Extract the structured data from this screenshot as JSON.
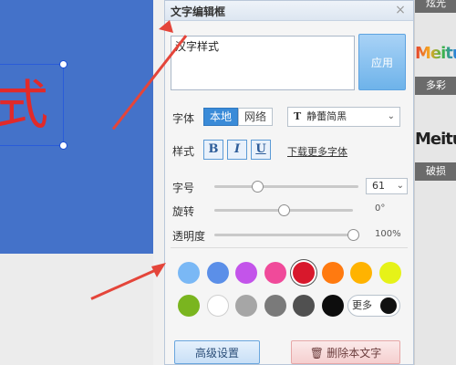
{
  "canvas": {
    "preview_text": "式",
    "preview_color": "#e12a2a",
    "background": "#4472c9"
  },
  "right_strip": [
    {
      "label": "炫光",
      "sample": ""
    },
    {
      "label": "多彩",
      "sample": "Meitu"
    },
    {
      "label": "破损",
      "sample": "Meitu"
    }
  ],
  "dialog": {
    "title": "文字编辑框",
    "close_icon": "×",
    "text_value": "汉字样式",
    "apply_label": "应用",
    "font_label": "字体",
    "font_source": {
      "local": "本地",
      "network": "网络",
      "selected": "local"
    },
    "font_select": {
      "icon": "T",
      "value": "静蕾简黑"
    },
    "style_label": "样式",
    "style_buttons": {
      "bold": "B",
      "italic": "I",
      "underline": "U"
    },
    "more_fonts_link": "下载更多字体",
    "size_label": "字号",
    "size_value": "61",
    "size_position": 0.3,
    "rotate_label": "旋转",
    "rotate_value": "0°",
    "rotate_position": 0.5,
    "opacity_label": "透明度",
    "opacity_value": "100%",
    "opacity_position": 1.0,
    "swatches_row1": [
      "#7ab8f5",
      "#5b8fe8",
      "#c354ea",
      "#f04a9a",
      "#d8182c",
      "#ff7a10",
      "#ffb300",
      "#e6f218"
    ],
    "swatches_row2": [
      "#7ab51f",
      "#ffffff",
      "#a6a6a6",
      "#7a7a7a",
      "#505050",
      "#0d0d0d"
    ],
    "selected_swatch": "#d8182c",
    "more_colors_label": "更多",
    "advanced_label": "高级设置",
    "delete_label": "删除本文字"
  }
}
